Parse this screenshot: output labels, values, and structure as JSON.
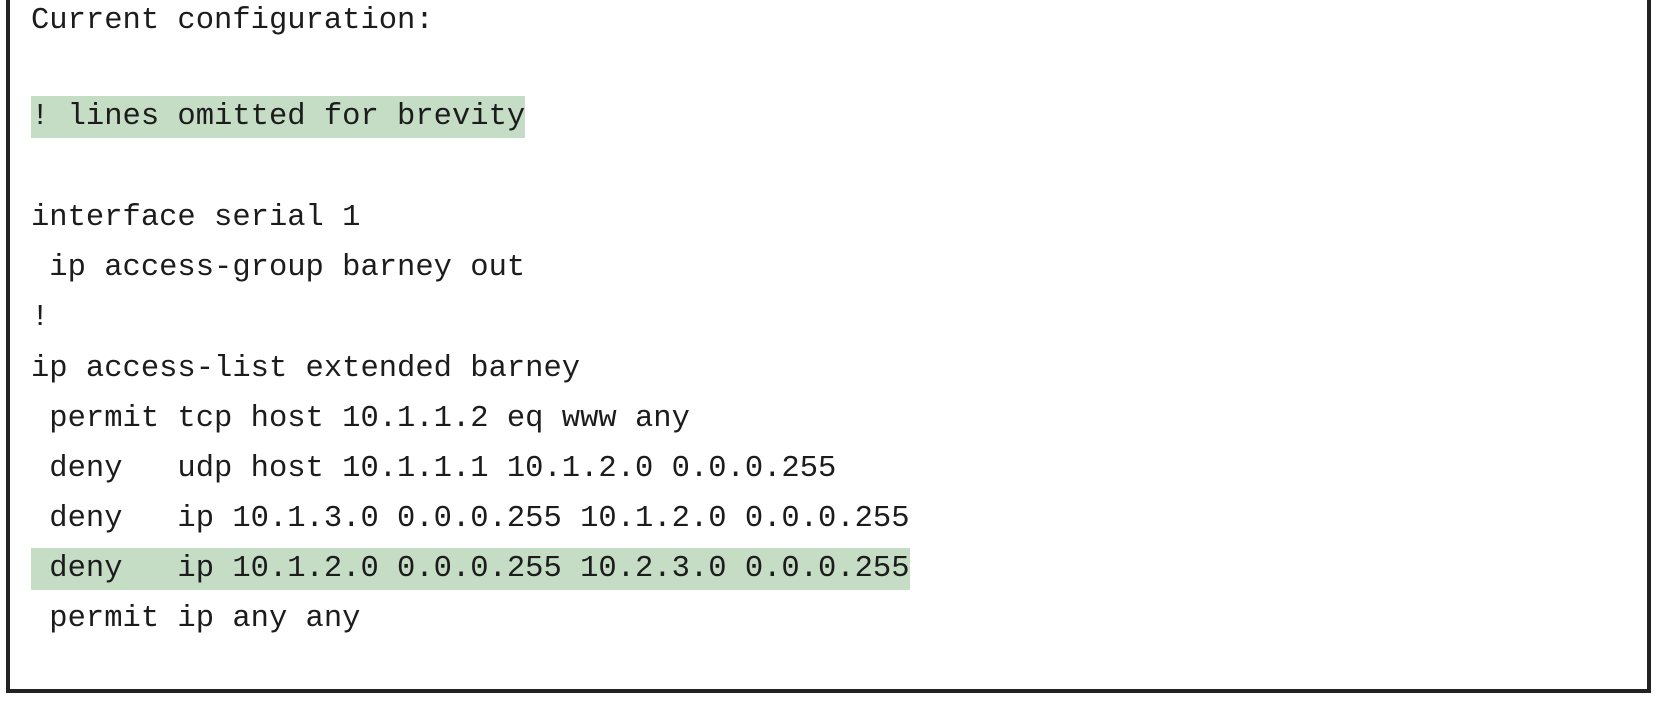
{
  "config": {
    "header": "Current configuration:",
    "lines": [
      {
        "text": "! lines omitted for brevity",
        "highlight": true
      },
      {
        "text": "",
        "highlight": false
      },
      {
        "text": "interface serial 1",
        "highlight": false
      },
      {
        "text": " ip access-group barney out",
        "highlight": false
      },
      {
        "text": "!",
        "highlight": false
      },
      {
        "text": "ip access-list extended barney",
        "highlight": false
      },
      {
        "text": " permit tcp host 10.1.1.2 eq www any",
        "highlight": false
      },
      {
        "text": " deny   udp host 10.1.1.1 10.1.2.0 0.0.0.255",
        "highlight": false
      },
      {
        "text": " deny   ip 10.1.3.0 0.0.0.255 10.1.2.0 0.0.0.255",
        "highlight": false
      },
      {
        "text": " deny   ip 10.1.2.0 0.0.0.255 10.2.3.0 0.0.0.255",
        "highlight": true
      },
      {
        "text": " permit ip any any",
        "highlight": false
      }
    ],
    "highlight_color": "#c5dcc5",
    "border_color": "#222222"
  }
}
